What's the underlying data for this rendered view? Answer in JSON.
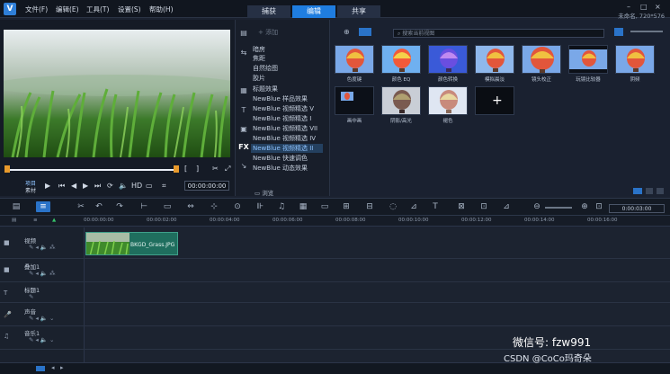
{
  "app": {
    "logo_text": "V",
    "menu": [
      "文件(F)",
      "编辑(E)",
      "工具(T)",
      "设置(S)",
      "帮助(H)"
    ],
    "tabs": [
      "捕获",
      "编辑",
      "共享"
    ],
    "active_tab": "编辑",
    "project_info": "未命名, 720*576",
    "window_controls": [
      "–",
      "□",
      "×"
    ]
  },
  "preview": {
    "project_label": "项目",
    "clip_label": "素材",
    "hd_label": "HD",
    "timecode": "00:00:00:00",
    "trim_in": "[",
    "trim_out": "]"
  },
  "library": {
    "add_label": "添加",
    "folders": [
      "暗房",
      "焦距",
      "自然绘图",
      "胶片",
      "标题效果",
      "NewBlue 样品效果",
      "NewBlue 视频精选 V",
      "NewBlue 视频精选 I",
      "NewBlue 视频精选 VII",
      "NewBlue 视频精选 IV",
      "NewBlue 视频精选 II",
      "NewBlue 快速调色",
      "NewBlue 动态效果"
    ],
    "selected_folder": "NewBlue 视频精选 II",
    "browse_label": "浏览",
    "side_icons": [
      "media-icon",
      "transition-icon",
      "title-icon",
      "graphic-icon",
      "filter-icon",
      "path-icon"
    ]
  },
  "effects": {
    "search_placeholder": "搜索当前视图",
    "items": [
      "色度键",
      "颜色 EQ",
      "颜色转换",
      "模拟晨淡",
      "镜头校正",
      "玩镜比较器",
      "阴频",
      "画中画",
      "阴影/高光",
      "褪色",
      ""
    ],
    "colors": {
      "balloon_sky": "#7aa8e8",
      "balloon": "#e2563b"
    }
  },
  "timeline": {
    "ruler": [
      "00:00:00:00",
      "00:00:02:00",
      "00:00:04:00",
      "00:00:06:00",
      "00:00:08:00",
      "00:00:10:00",
      "00:00:12:00",
      "00:00:14:00",
      "00:00:16:00"
    ],
    "zoom_timecode": "0:00:03:00",
    "tracks": [
      {
        "name": "视频",
        "icon": "video-track-icon"
      },
      {
        "name": "叠加1",
        "icon": "overlay-track-icon"
      },
      {
        "name": "标题1",
        "icon": "title-track-icon"
      },
      {
        "name": "声音",
        "icon": "voice-track-icon"
      },
      {
        "name": "音乐1",
        "icon": "music-track-icon"
      }
    ],
    "clip_name": "BKGD_Grass.JPG"
  },
  "watermark": {
    "line1": "微信号: fzw991",
    "line2": "CSDN @CoCo玛奇朵"
  }
}
